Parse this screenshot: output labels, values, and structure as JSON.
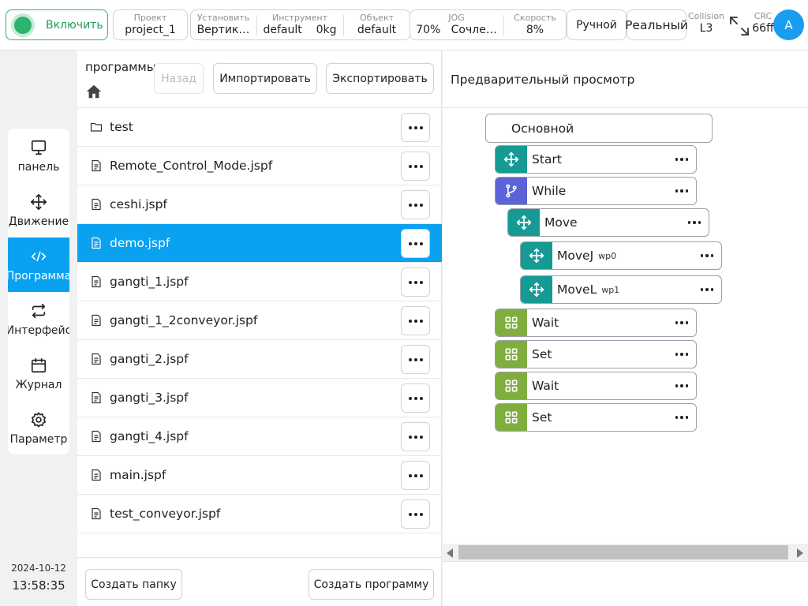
{
  "topbar": {
    "power_label": "Включить",
    "project": {
      "caption": "Проект",
      "value": "project_1"
    },
    "install": {
      "caption": "Установить",
      "value": "Вертик…"
    },
    "tool": {
      "caption": "Инструмент",
      "value": "default",
      "weight": "0kg"
    },
    "object": {
      "caption": "Объект",
      "value": "default"
    },
    "jog": {
      "caption": "JOG",
      "value": "70%",
      "mode": "Сочле…"
    },
    "speed": {
      "caption": "Скорость",
      "value": "8%"
    },
    "mode_label": "Ручной",
    "real_label": "Реальный",
    "collision": {
      "caption": "Collision",
      "value": "L3"
    },
    "crc": {
      "caption": "CRC",
      "value": "66ff"
    },
    "avatar_letter": "A"
  },
  "nav": {
    "items": [
      {
        "label": "панель",
        "icon": "monitor-icon"
      },
      {
        "label": "Движение",
        "icon": "move-icon"
      },
      {
        "label": "Программа",
        "icon": "code-icon",
        "active": true
      },
      {
        "label": "Интерфейс",
        "icon": "swap-icon"
      },
      {
        "label": "Журнал",
        "icon": "calendar-icon"
      },
      {
        "label": "Параметр",
        "icon": "gear-icon"
      }
    ]
  },
  "status": {
    "date": "2024-10-12",
    "time": "13:58:35"
  },
  "files": {
    "title": "программы",
    "back_label": "Назад",
    "import_label": "Импортировать",
    "export_label": "Экспортировать",
    "items": [
      {
        "name": "test",
        "type": "folder"
      },
      {
        "name": "Remote_Control_Mode.jspf",
        "type": "file"
      },
      {
        "name": "ceshi.jspf",
        "type": "file"
      },
      {
        "name": "demo.jspf",
        "type": "file",
        "selected": true
      },
      {
        "name": "gangti_1.jspf",
        "type": "file"
      },
      {
        "name": "gangti_1_2conveyor.jspf",
        "type": "file"
      },
      {
        "name": "gangti_2.jspf",
        "type": "file"
      },
      {
        "name": "gangti_3.jspf",
        "type": "file"
      },
      {
        "name": "gangti_4.jspf",
        "type": "file"
      },
      {
        "name": "main.jspf",
        "type": "file"
      },
      {
        "name": "test_conveyor.jspf",
        "type": "file"
      }
    ],
    "create_folder_label": "Создать папку",
    "create_program_label": "Создать программу"
  },
  "preview": {
    "title": "Предварительный просмотр",
    "root": "Основной",
    "nodes": [
      {
        "label": "Start",
        "icon": "move-icon",
        "color": "#159a94"
      },
      {
        "label": "While",
        "icon": "branch-icon",
        "color": "#5b63d6"
      },
      {
        "label": "Move",
        "icon": "move-icon",
        "color": "#159a94"
      },
      {
        "label": "MoveJ",
        "sub": "wp0",
        "icon": "move-icon",
        "color": "#159a94"
      },
      {
        "label": "MoveL",
        "sub": "wp1",
        "icon": "move-icon",
        "color": "#159a94"
      },
      {
        "label": "Wait",
        "icon": "grid-icon",
        "color": "#7fae3e"
      },
      {
        "label": "Set",
        "icon": "grid-icon",
        "color": "#7fae3e"
      },
      {
        "label": "Wait",
        "icon": "grid-icon",
        "color": "#7fae3e"
      },
      {
        "label": "Set",
        "icon": "grid-icon",
        "color": "#7fae3e"
      }
    ]
  }
}
